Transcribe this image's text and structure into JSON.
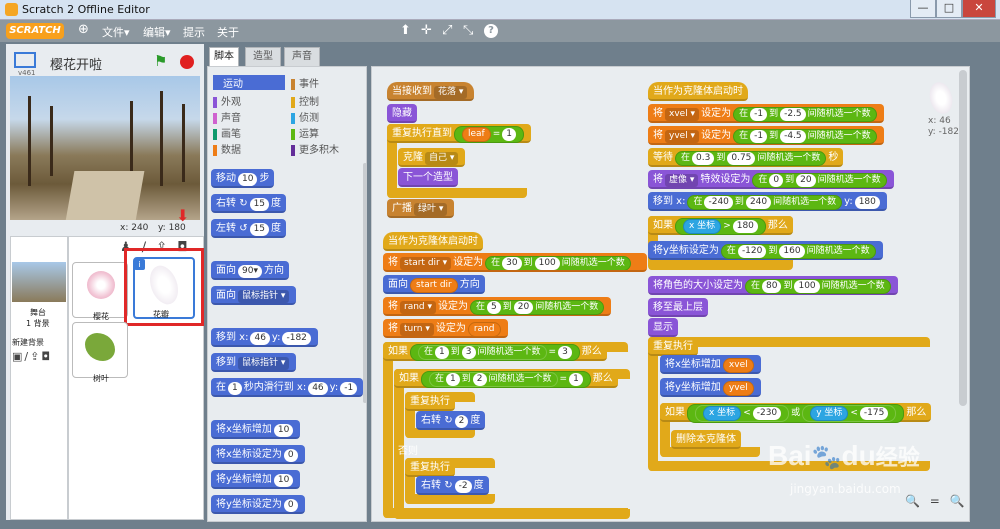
{
  "window": {
    "title": "Scratch 2 Offline Editor",
    "controls": [
      "—",
      "□",
      "✕"
    ]
  },
  "menu": {
    "logo": "SCRATCH",
    "globe": "⊕",
    "items": [
      "文件▾",
      "编辑▾",
      "提示",
      "关于"
    ],
    "tools": [
      "⬆",
      "✛",
      "⤢",
      "⤡",
      "?"
    ]
  },
  "stage": {
    "sprite_name": "樱花开啦",
    "version": "v461",
    "coords": {
      "x_label": "x: 240",
      "y_label": "y: 180"
    },
    "flag": "⚑"
  },
  "sprites": {
    "stage_label": "舞台",
    "backdrop_count": "1 背景",
    "new_backdrop": "新建背景",
    "items": [
      {
        "name": "樱花"
      },
      {
        "name": "花瓣"
      },
      {
        "name": "树叶"
      }
    ],
    "info": "i"
  },
  "tabs": [
    "脚本",
    "造型",
    "声音"
  ],
  "categories": {
    "left": [
      "运动",
      "外观",
      "声音",
      "画笔",
      "数据"
    ],
    "right": [
      "事件",
      "控制",
      "侦测",
      "运算",
      "更多积木"
    ],
    "colors": [
      "#4a6cd4",
      "#8a55d7",
      "#cf63cf",
      "#0e9a6c",
      "#ee7d16",
      "#c88330",
      "#e1a91a",
      "#2ca5e2",
      "#5cb712",
      "#632d99"
    ]
  },
  "palette": {
    "move": [
      "移动",
      "10",
      "步"
    ],
    "turn_right": [
      "右转",
      "↻",
      "15",
      "度"
    ],
    "turn_left": [
      "左转",
      "↺",
      "15",
      "度"
    ],
    "point_dir": [
      "面向",
      "90▾",
      "方向"
    ],
    "point_towards": [
      "面向",
      "鼠标指针 ▾"
    ],
    "goto_xy": [
      "移到 x:",
      "46",
      "y:",
      "-182"
    ],
    "goto": [
      "移到",
      "鼠标指针 ▾"
    ],
    "glide": [
      "在",
      "1",
      "秒内滑行到 x:",
      "46",
      "y:",
      "-1"
    ],
    "change_x": [
      "将x坐标增加",
      "10"
    ],
    "set_x": [
      "将x坐标设定为",
      "0"
    ],
    "change_y": [
      "将y坐标增加",
      "10"
    ],
    "set_y": [
      "将y坐标设定为",
      "0"
    ]
  },
  "scripts": {
    "s1": {
      "hat": [
        "当接收到",
        "花落 ▾"
      ],
      "hide": "隐藏",
      "repeat_until": [
        "重复执行直到",
        "leaf",
        "=",
        "1"
      ],
      "clone": [
        "克隆",
        "自己 ▾"
      ],
      "next": "下一个造型",
      "broadcast": [
        "广播",
        "绿叶 ▾"
      ]
    },
    "s2": {
      "hat": "当作为克隆体启动时",
      "set_startdir": [
        "将",
        "start dir ▾",
        "设定为",
        "在",
        "30",
        "到",
        "100",
        "间随机选一个数"
      ],
      "point": [
        "面向",
        "start dir",
        "方向"
      ],
      "set_rand": [
        "将",
        "rand ▾",
        "设定为",
        "在",
        "5",
        "到",
        "20",
        "间随机选一个数"
      ],
      "set_turn": [
        "将",
        "turn ▾",
        "设定为",
        "rand"
      ],
      "if1": [
        "如果",
        "在",
        "1",
        "到",
        "3",
        "间随机选一个数",
        "=",
        "3",
        "那么"
      ],
      "if2": [
        "如果",
        "在",
        "1",
        "到",
        "2",
        "间随机选一个数",
        "=",
        "1",
        "那么"
      ],
      "forever1": "重复执行",
      "turn1": [
        "右转",
        "↻",
        "2",
        "度"
      ],
      "else": "否则",
      "forever2": "重复执行",
      "turn2": [
        "右转",
        "↻",
        "-2",
        "度"
      ]
    },
    "s3": {
      "hat": "当作为克隆体启动时",
      "set_xvel": [
        "将",
        "xvel ▾",
        "设定为",
        "在",
        "-1",
        "到",
        "-2.5",
        "间随机选一个数"
      ],
      "set_yvel": [
        "将",
        "yvel ▾",
        "设定为",
        "在",
        "-1",
        "到",
        "-4.5",
        "间随机选一个数"
      ],
      "wait": [
        "等待",
        "在",
        "0.3",
        "到",
        "0.75",
        "间随机选一个数",
        "秒"
      ],
      "effect": [
        "将",
        "虚像 ▾",
        "特效设定为",
        "在",
        "0",
        "到",
        "20",
        "间随机选一个数"
      ],
      "goto": [
        "移到 x:",
        "在",
        "-240",
        "到",
        "240",
        "间随机选一个数",
        "y:",
        "180"
      ],
      "if_x": [
        "如果",
        "x 坐标",
        ">",
        "180",
        "那么"
      ],
      "set_y": [
        "将y坐标设定为",
        "在",
        "-120",
        "到",
        "160",
        "间随机选一个数"
      ],
      "size": [
        "将角色的大小设定为",
        "在",
        "80",
        "到",
        "100",
        "间随机选一个数"
      ],
      "front": "移至最上层",
      "show": "显示",
      "forever": "重复执行",
      "chx": [
        "将x坐标增加",
        "xvel"
      ],
      "chy": [
        "将y坐标增加",
        "yvel"
      ],
      "if_edge": [
        "如果",
        "x 坐标",
        "<",
        "-230",
        "或",
        "y 坐标",
        "<",
        "-175",
        "那么"
      ],
      "delete": "删除本克隆体"
    }
  },
  "sprite_info": {
    "x": "x: 46",
    "y": "y: -182"
  },
  "zoom": [
    "🔍",
    "=",
    "🔍"
  ],
  "watermark": {
    "brand": "Bai",
    "brand2": "du",
    "cn": "经验",
    "url": "jingyan.baidu.com"
  }
}
